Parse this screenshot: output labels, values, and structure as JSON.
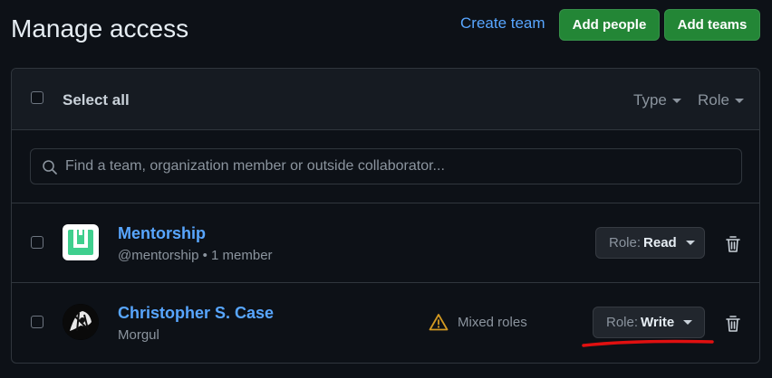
{
  "header": {
    "title": "Manage access",
    "create_team": "Create team",
    "add_people": "Add people",
    "add_teams": "Add teams"
  },
  "toolbar": {
    "select_all": "Select all",
    "type_filter": "Type",
    "role_filter": "Role"
  },
  "search": {
    "placeholder": "Find a team, organization member or outside collaborator..."
  },
  "members": [
    {
      "name": "Mentorship",
      "subtitle": "@mentorship • 1 member",
      "role_prefix": "Role:",
      "role": "Read",
      "avatar": "team-logo-icon"
    },
    {
      "name": "Christopher S. Case",
      "subtitle": "Morgul",
      "role_prefix": "Role:",
      "role": "Write",
      "mixed_roles": "Mixed roles",
      "avatar": "user-avatar"
    }
  ],
  "colors": {
    "background": "#0d1117",
    "accent_link": "#58a6ff",
    "primary_button": "#238636",
    "warning": "#d29922",
    "annotation_red": "#e01010"
  }
}
